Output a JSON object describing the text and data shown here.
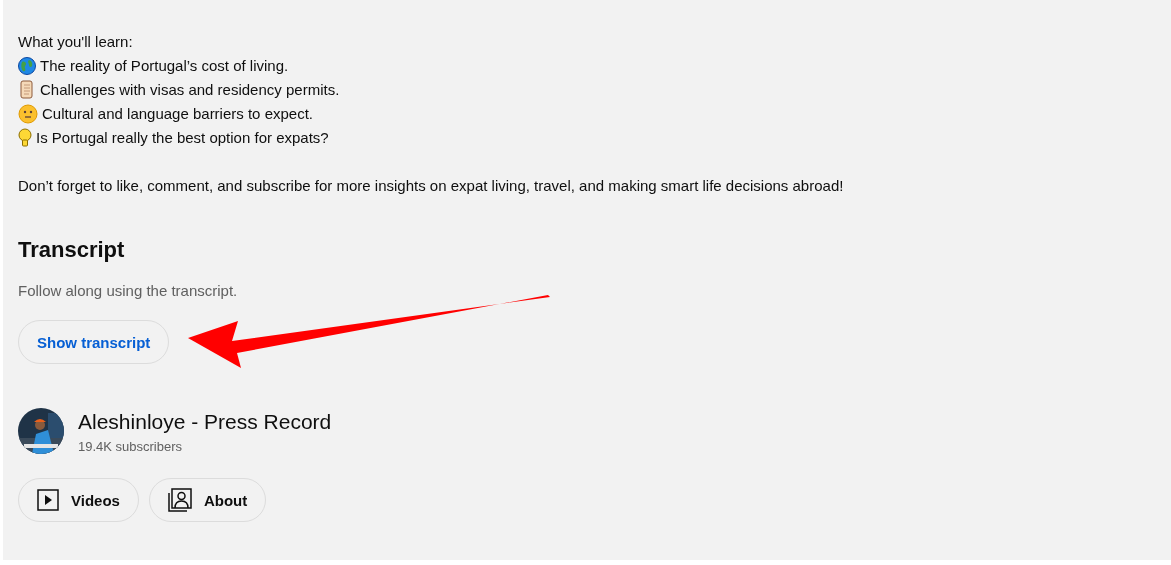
{
  "description": {
    "intro": "What you'll learn:",
    "points": [
      {
        "kind": "globe",
        "text": "The reality of Portugal’s cost of living."
      },
      {
        "kind": "scroll",
        "text": "Challenges with visas and residency permits."
      },
      {
        "kind": "face",
        "text": "Cultural and language barriers to expect."
      },
      {
        "kind": "bulb",
        "text": "Is Portugal really the best option for expats?"
      }
    ],
    "outro": "Don’t forget to like, comment, and subscribe for more insights on expat living, travel, and making smart life decisions abroad!"
  },
  "transcript": {
    "title": "Transcript",
    "hint": "Follow along using the transcript.",
    "button": "Show transcript"
  },
  "channel": {
    "name": "Aleshinloye - Press Record",
    "subscribers": "19.4K subscribers",
    "buttons": [
      {
        "kind": "videos",
        "label": "Videos"
      },
      {
        "kind": "about",
        "label": "About"
      }
    ]
  }
}
